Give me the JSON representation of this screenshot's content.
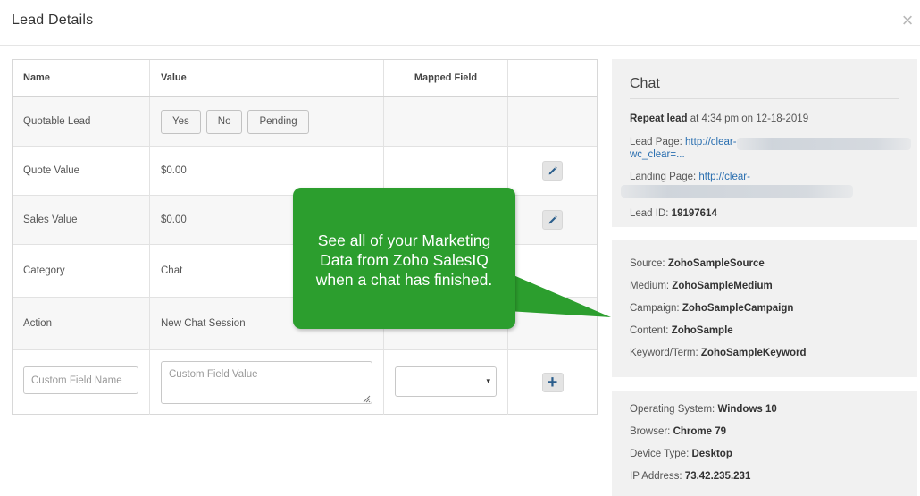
{
  "modal": {
    "title": "Lead Details",
    "close_icon": "×"
  },
  "table": {
    "headers": {
      "name": "Name",
      "value": "Value",
      "mapped": "Mapped Field"
    },
    "rows": [
      {
        "name": "Quotable Lead",
        "options": [
          "Yes",
          "No",
          "Pending"
        ]
      },
      {
        "name": "Quote Value",
        "value": "$0.00"
      },
      {
        "name": "Sales Value",
        "value": "$0.00"
      },
      {
        "name": "Category",
        "value": "Chat"
      },
      {
        "name": "Action",
        "value": "New Chat Session"
      }
    ],
    "custom": {
      "name_placeholder": "Custom Field Name",
      "value_placeholder": "Custom Field Value",
      "select_arrow": "▾",
      "add_label": "+"
    }
  },
  "chat_panel": {
    "title": "Chat",
    "repeat_lead_label": "Repeat lead",
    "repeat_lead_value": " at 4:34 pm on 12-18-2019",
    "lead_page_label": "Lead Page: ",
    "lead_page_link": "http://clear-",
    "lead_page_link_cont": "wc_clear=...",
    "landing_page_label": "Landing Page: ",
    "landing_page_link": "http://clear-",
    "lead_id_label": "Lead ID: ",
    "lead_id": "19197614"
  },
  "marketing_panel": {
    "source_label": "Source: ",
    "source": "ZohoSampleSource",
    "medium_label": "Medium: ",
    "medium": "ZohoSampleMedium",
    "campaign_label": "Campaign: ",
    "campaign": "ZohoSampleCampaign",
    "content_label": "Content: ",
    "content": "ZohoSample",
    "keyword_label": "Keyword/Term: ",
    "keyword": "ZohoSampleKeyword"
  },
  "device_panel": {
    "os_label": "Operating System: ",
    "os": "Windows 10",
    "browser_label": "Browser: ",
    "browser": "Chrome 79",
    "device_label": "Device Type: ",
    "device": "Desktop",
    "ip_label": "IP Address: ",
    "ip": "73.42.235.231"
  },
  "callout": {
    "line1": "See all of your Marketing",
    "line2": "Data from Zoho SalesIQ",
    "line3": "when a chat has finished."
  },
  "colors": {
    "callout_green": "#2c9e2e",
    "link_blue": "#2a6fb0",
    "icon_blue": "#2b5e8c",
    "panel_gray": "#f1f1f1"
  },
  "icons": {
    "edit": "pencil-icon",
    "add": "plus-icon",
    "close": "close-icon"
  }
}
